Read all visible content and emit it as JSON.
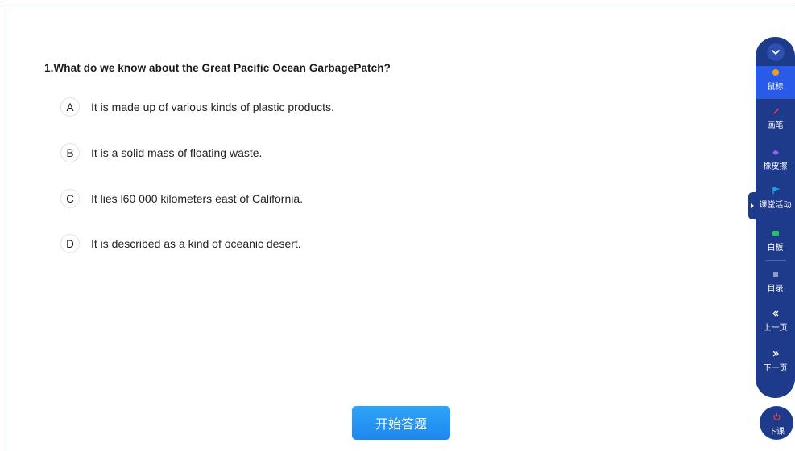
{
  "question": {
    "text": "1.What do we know about the Great Pacific Ocean GarbagePatch?"
  },
  "options": [
    {
      "letter": "A",
      "text": "It is made up of various kinds of plastic products."
    },
    {
      "letter": "B",
      "text": "It is a solid mass of floating waste."
    },
    {
      "letter": "C",
      "text": "It lies l60 000 kilometers east of California."
    },
    {
      "letter": "D",
      "text": "It is described as a kind of oceanic desert."
    }
  ],
  "start_button": {
    "label": "开始答题"
  },
  "toolbar": {
    "collapse_icon": "chevron-down-icon",
    "items": [
      {
        "label": "鼠标",
        "icon": "hand-icon",
        "icon_color": "#f59e0b",
        "active": true
      },
      {
        "label": "画笔",
        "icon": "pen-icon",
        "icon_color": "#ef4444"
      },
      {
        "label": "橡皮擦",
        "icon": "eraser-icon",
        "icon_color": "#a855f7"
      },
      {
        "label": "课堂活动",
        "icon": "flag-icon",
        "icon_color": "#0ea5e9"
      },
      {
        "label": "白板",
        "icon": "whiteboard-icon",
        "icon_color": "#22c55e"
      },
      {
        "label": "目录",
        "icon": "list-icon",
        "icon_color": "#ffffff"
      },
      {
        "label": "上一页",
        "icon": "double-chevron-left-icon",
        "icon_color": "#ffffff"
      },
      {
        "label": "下一页",
        "icon": "double-chevron-right-icon",
        "icon_color": "#ffffff"
      }
    ]
  },
  "end_button": {
    "label": "下课",
    "icon": "power-icon",
    "icon_color": "#ef4444"
  },
  "colors": {
    "frame_border": "#3b43d6",
    "toolbar_bg": "#1e3a8a",
    "toolbar_active": "#2a5be8",
    "start_button": "#1f86ee"
  }
}
